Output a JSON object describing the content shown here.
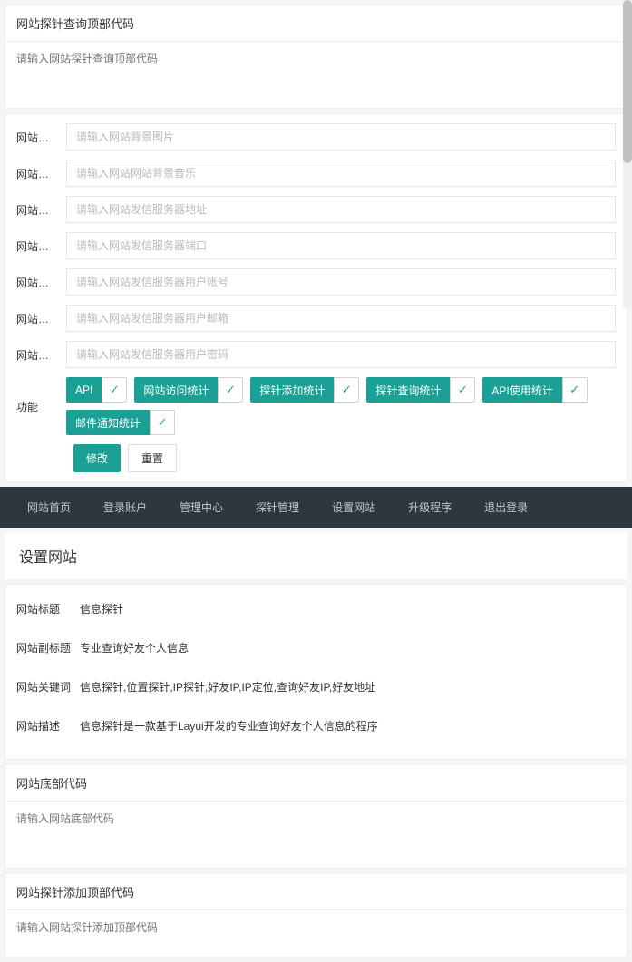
{
  "top_form": {
    "panel1": {
      "title": "网站探针查询顶部代码",
      "placeholder": "请输入网站探针查询顶部代码"
    },
    "fields": [
      {
        "label": "网站背景…",
        "placeholder": "请输入网站背景图片"
      },
      {
        "label": "网站背景…",
        "placeholder": "请输入网站网站背景音乐"
      },
      {
        "label": "网站发信…",
        "placeholder": "请输入网站发信服务器地址"
      },
      {
        "label": "网站发信…",
        "placeholder": "请输入网站发信服务器端口"
      },
      {
        "label": "网站发信…",
        "placeholder": "请输入网站发信服务器用户帐号"
      },
      {
        "label": "网站发信…",
        "placeholder": "请输入网站发信服务器用户邮箱"
      },
      {
        "label": "网站发信…",
        "placeholder": "请输入网站发信服务器用户密码"
      }
    ],
    "feature_label": "功能",
    "features": [
      "API",
      "网站访问统计",
      "探针添加统计",
      "探针查询统计",
      "API使用统计",
      "邮件通知统计"
    ],
    "btn_submit": "修改",
    "btn_reset": "重置"
  },
  "nav": [
    "网站首页",
    "登录账户",
    "管理中心",
    "探针管理",
    "设置网站",
    "升级程序",
    "退出登录"
  ],
  "page_title": "设置网站",
  "bottom_form": {
    "rows": [
      {
        "label": "网站标题",
        "value": "信息探针"
      },
      {
        "label": "网站副标题",
        "value": "专业查询好友个人信息"
      },
      {
        "label": "网站关键词",
        "value": "信息探针,位置探针,IP探针,好友IP,IP定位,查询好友IP,好友地址"
      },
      {
        "label": "网站描述",
        "value": "信息探针是一款基于Layui开发的专业查询好友个人信息的程序"
      }
    ],
    "panel_bottom_code": {
      "title": "网站底部代码",
      "placeholder": "请输入网站底部代码"
    },
    "panel_probe_add": {
      "title": "网站探针添加顶部代码",
      "placeholder": "请输入网站探针添加顶部代码"
    }
  }
}
